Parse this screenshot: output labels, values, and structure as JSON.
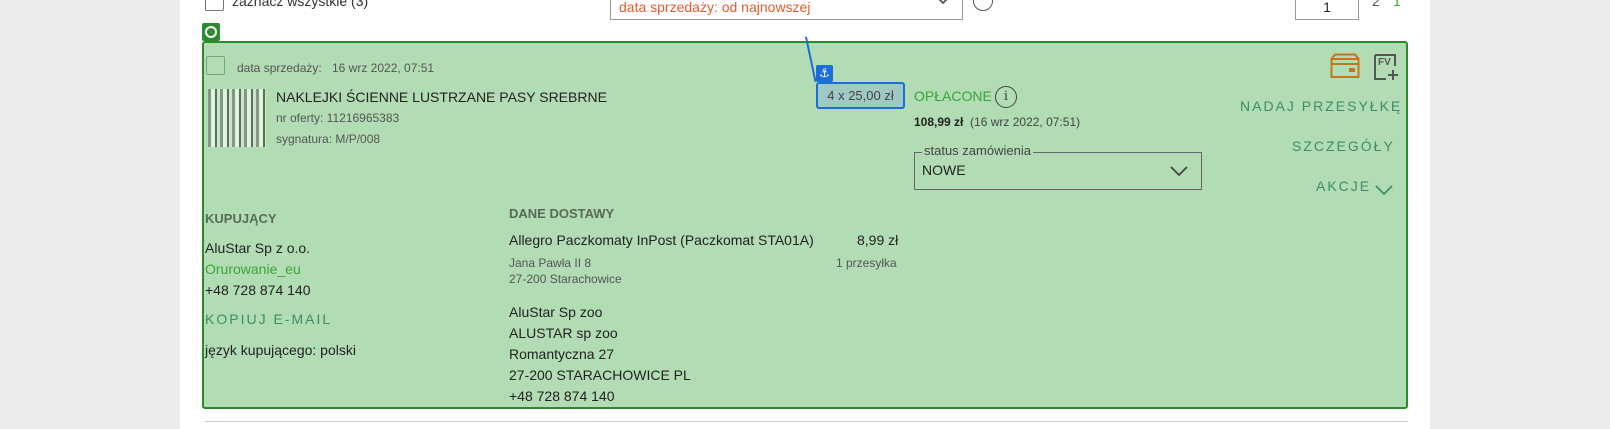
{
  "toolbar": {
    "select_all_label": "zaznacz wszystkie (3)",
    "sort_value": "data sprzedaży: od najnowszej",
    "page_input_value": "1",
    "page_next_a": "2",
    "page_next_b": "1"
  },
  "order": {
    "sale_date_label": "data sprzedaży:",
    "sale_date_value": "16 wrz 2022, 07:51",
    "product_title": "NAKLEJKI ŚCIENNE LUSTRZANE PASY SREBRNE",
    "offer_number": "nr oferty: 11216965383",
    "signature": "sygnatura: M/P/008",
    "quantity_price": "4 x 25,00 zł",
    "payment_status": "OPŁACONE",
    "info_icon_glyph": "i",
    "paid_amount": "108,99 zł",
    "paid_date": "(16 wrz 2022, 07:51)",
    "order_status_label": "status zamówienia",
    "order_status_value": "NOWE",
    "actions": {
      "ship": "NADAJ PRZESYŁKĘ",
      "details": "SZCZEGÓŁY",
      "more": "AKCJE"
    },
    "invoice_icon_text": "FV"
  },
  "buyer": {
    "heading": "KUPUJĄCY",
    "company": "AluStar Sp z o.o.",
    "login": "Orurowanie_eu",
    "phone": "+48 728 874 140",
    "copy_email": "KOPIUJ E-MAIL",
    "language": "język kupującego: polski"
  },
  "delivery": {
    "heading": "DANE DOSTAWY",
    "method": "Allegro Paczkomaty InPost (Paczkomat STA01A)",
    "cost": "8,99 zł",
    "locker_street": "Jana Pawła II 8",
    "locker_city": "27-200 Starachowice",
    "packages": "1 przesyłka",
    "recipient_name": "AluStar Sp zoo",
    "recipient_company": "ALUSTAR sp zoo",
    "recipient_street": "Romantyczna 27",
    "recipient_city": "27-200 STARACHOWICE PL",
    "recipient_phone": "+48 728 874 140"
  },
  "colors": {
    "card_background": "#b2dcb3",
    "card_border": "#2e8a2e",
    "accent_green": "#3aa43a",
    "action_teal": "#3b8e6a",
    "selection_blue": "#1a6fd6",
    "sort_text_orange": "#e25c2c"
  },
  "icons": [
    "checkbox-icon",
    "chevron-down-icon",
    "info-icon",
    "anchor-icon",
    "package-icon",
    "invoice-add-icon",
    "target-icon"
  ]
}
